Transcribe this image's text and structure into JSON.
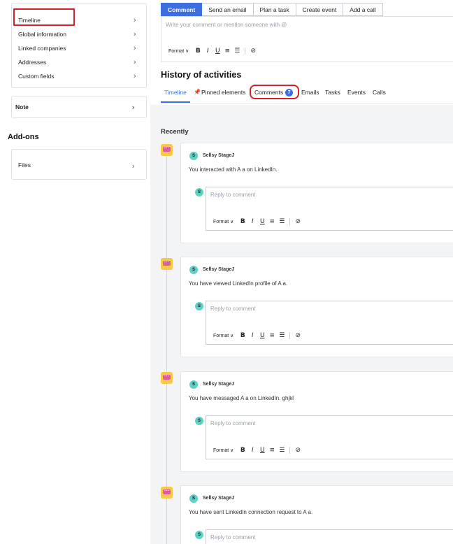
{
  "sidebar": {
    "nav_items": [
      {
        "label": "Timeline"
      },
      {
        "label": "Global information"
      },
      {
        "label": "Linked companies"
      },
      {
        "label": "Addresses"
      },
      {
        "label": "Custom fields"
      }
    ],
    "note_label": "Note",
    "addons_title": "Add-ons",
    "files_label": "Files",
    "chevron": "›"
  },
  "composer": {
    "tabs": [
      "Comment",
      "Send an email",
      "Plan a task",
      "Create event",
      "Add a call"
    ],
    "placeholder": "Write your comment or mention someone with @",
    "format_label": "Format ∨"
  },
  "history": {
    "title": "History of activities",
    "tabs": [
      "Timeline",
      "Pinned elements",
      "Comments",
      "Emails",
      "Tasks",
      "Events",
      "Calls"
    ],
    "comments_count": "7",
    "section_label": "Recently"
  },
  "activities": [
    {
      "author": "Sellsy StageJ",
      "avatar_letter": "S",
      "text": "You interacted with A a on LinkedIn.",
      "reply_placeholder": "Reply to comment"
    },
    {
      "author": "Sellsy StageJ",
      "avatar_letter": "S",
      "text": "You have viewed LinkedIn profile of A a.",
      "reply_placeholder": "Reply to comment"
    },
    {
      "author": "Sellsy StageJ",
      "avatar_letter": "S",
      "text": "You have messaged A a on LinkedIn. ghjkl",
      "reply_placeholder": "Reply to comment"
    },
    {
      "author": "Sellsy StageJ",
      "avatar_letter": "S",
      "text": "You have sent LinkedIn connection request to A a.",
      "reply_placeholder": "Reply to comment"
    }
  ],
  "colors": {
    "accent": "#3d6ee0",
    "highlight": "#d32029",
    "activity_icon": "#f7c948",
    "avatar": "#5ed1bf"
  }
}
